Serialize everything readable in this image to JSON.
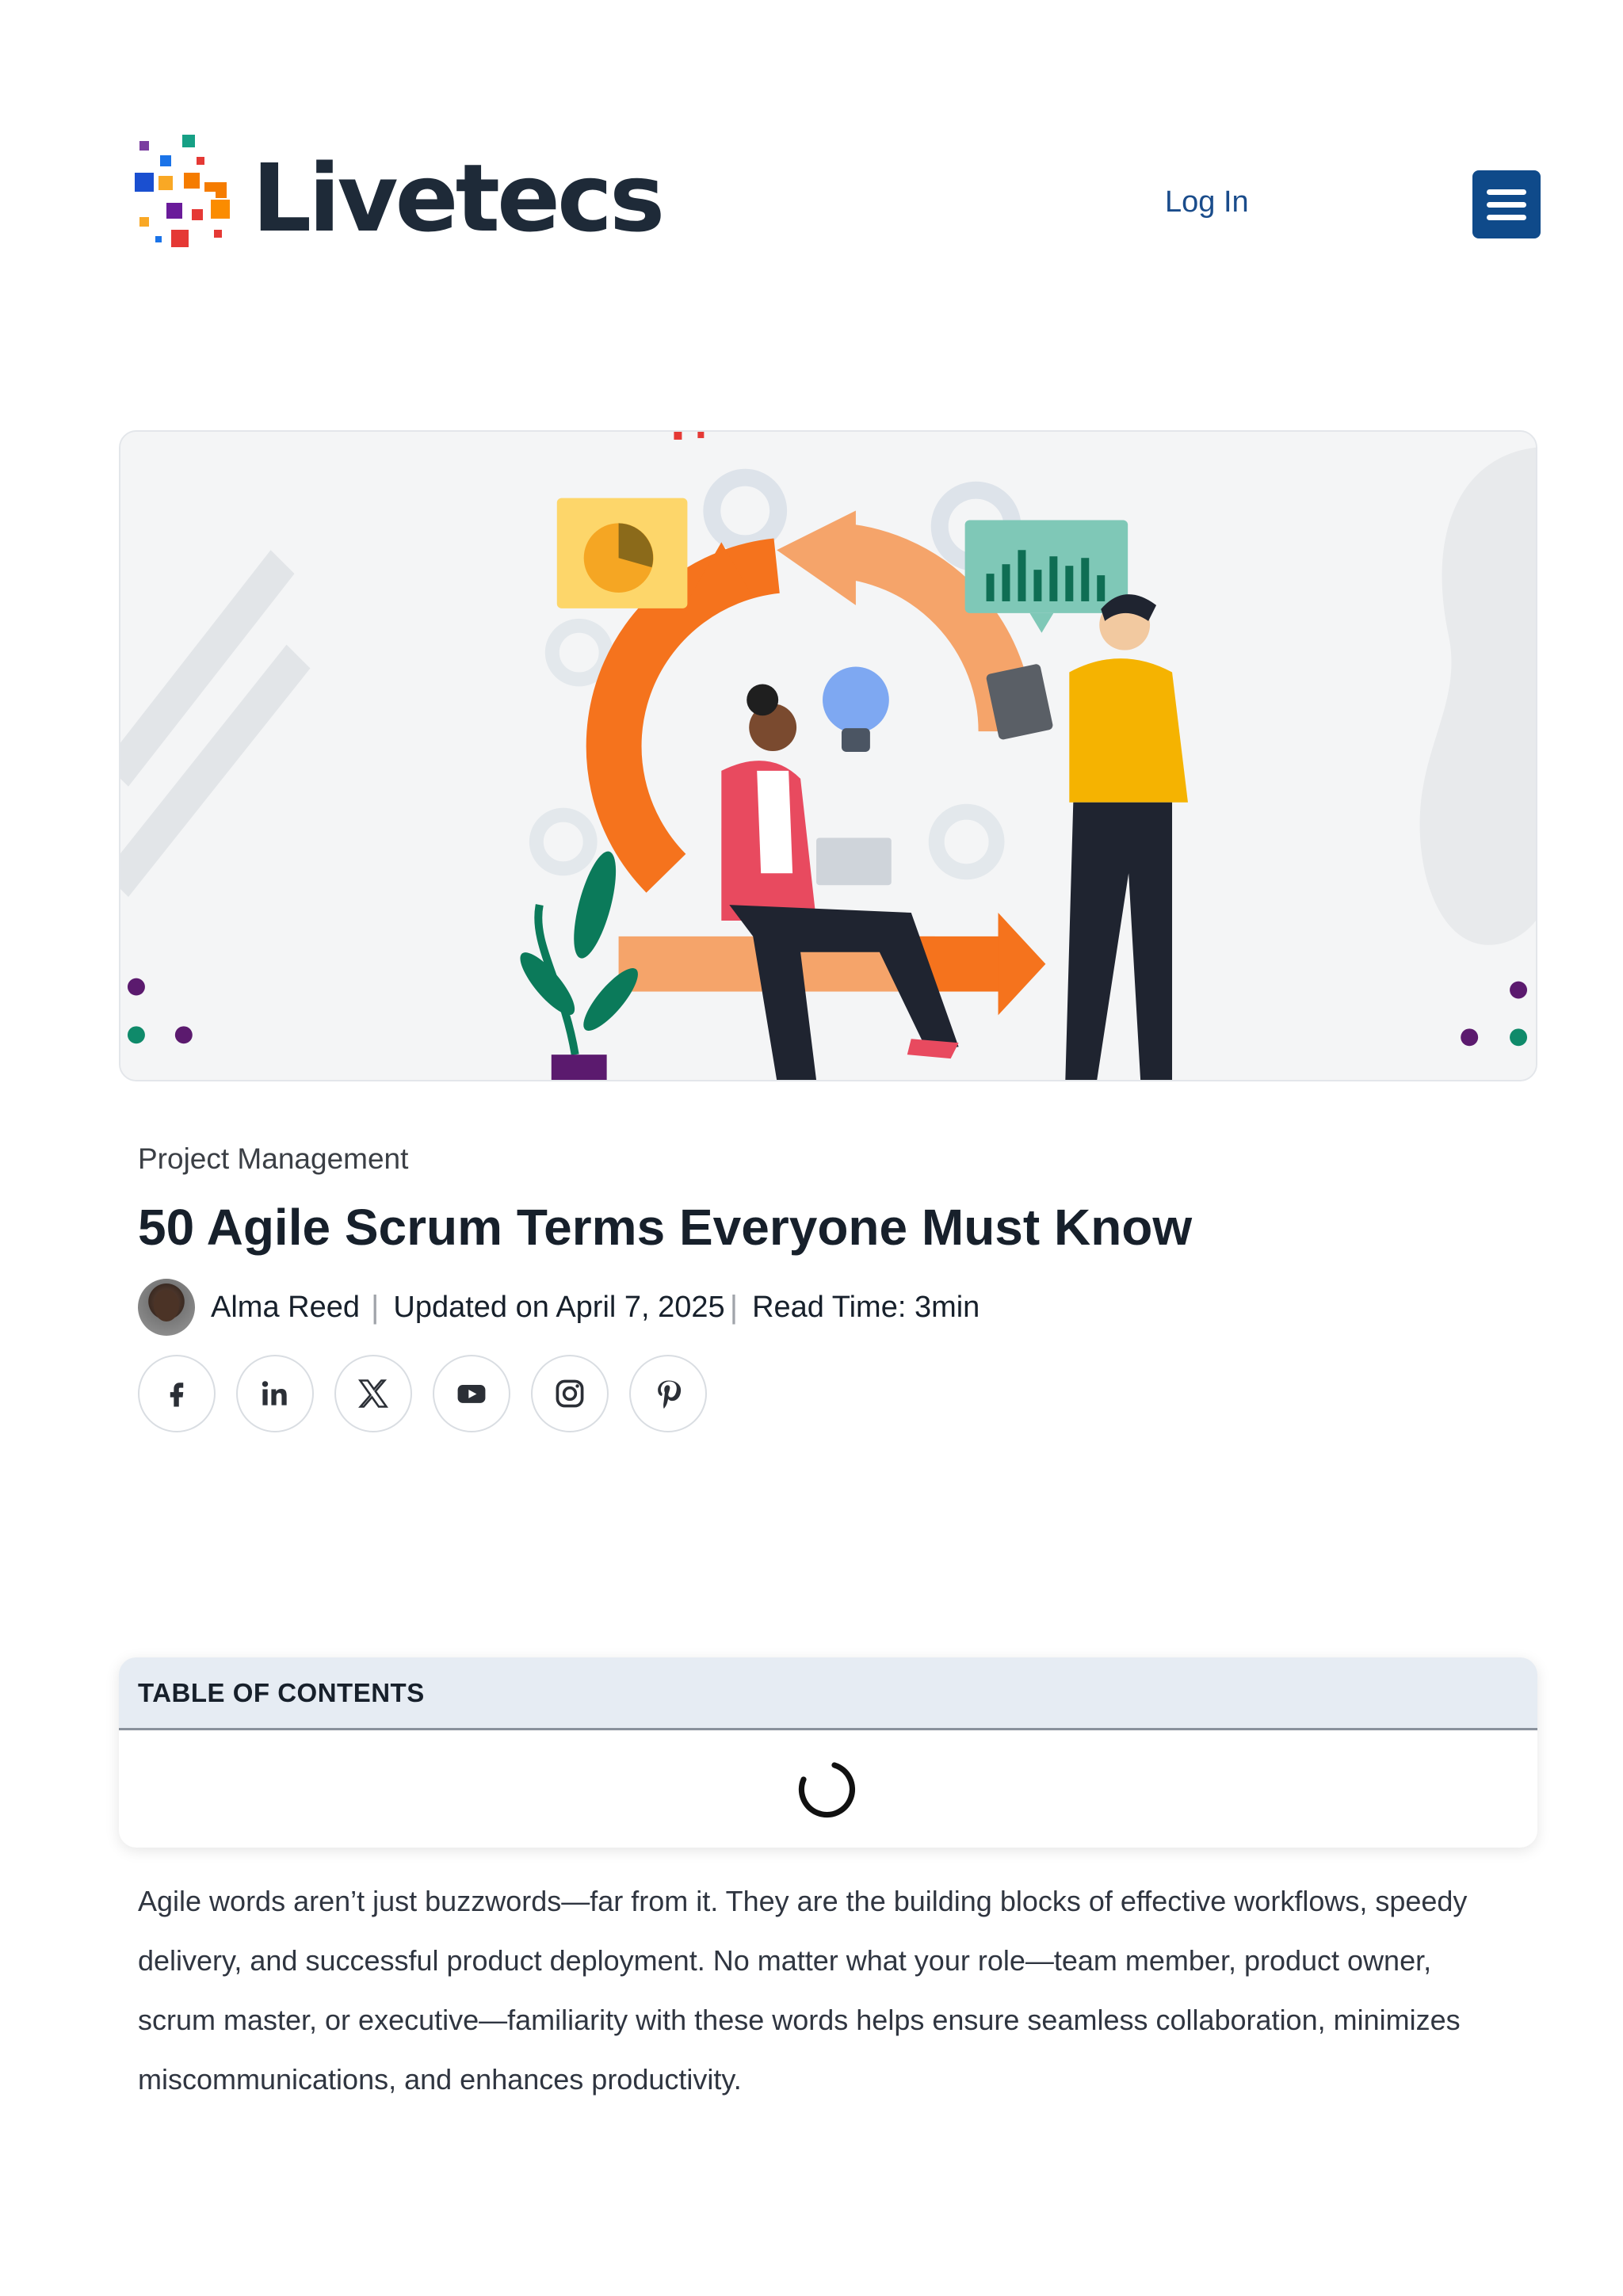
{
  "header": {
    "logo_text": "Livetecs",
    "login_label": "Log In",
    "menu_icon": "hamburger-icon"
  },
  "hero": {
    "image_description_icon": "agile-cycle-illustration"
  },
  "article": {
    "category": "Project Management",
    "title": "50 Agile Scrum Terms Everyone Must Know",
    "author": "Alma Reed",
    "updated": "Updated on April 7, 2025",
    "read_time": "Read Time: 3min",
    "separator": "|",
    "socials": [
      {
        "name": "facebook",
        "icon": "facebook-icon"
      },
      {
        "name": "linkedin",
        "icon": "linkedin-icon"
      },
      {
        "name": "x",
        "icon": "x-icon"
      },
      {
        "name": "youtube",
        "icon": "youtube-icon"
      },
      {
        "name": "instagram",
        "icon": "instagram-icon"
      },
      {
        "name": "pinterest",
        "icon": "pinterest-icon"
      }
    ]
  },
  "toc": {
    "heading": "TABLE OF CONTENTS",
    "loading_icon": "spinner-icon"
  },
  "body": {
    "intro": "Agile words aren’t just buzzwords—far from it. They are the building blocks of effective workflows, speedy delivery, and successful product deployment. No matter what your role—team member, product owner, scrum master, or executive—familiarity with these words helps ensure seamless collaboration, minimizes miscommunications, and enhances productivity."
  },
  "colors": {
    "brand_navy": "#1e2a38",
    "link_blue": "#1a4c8b",
    "menu_button": "#0f4a8a",
    "toc_header_bg": "#e6ecf3"
  }
}
